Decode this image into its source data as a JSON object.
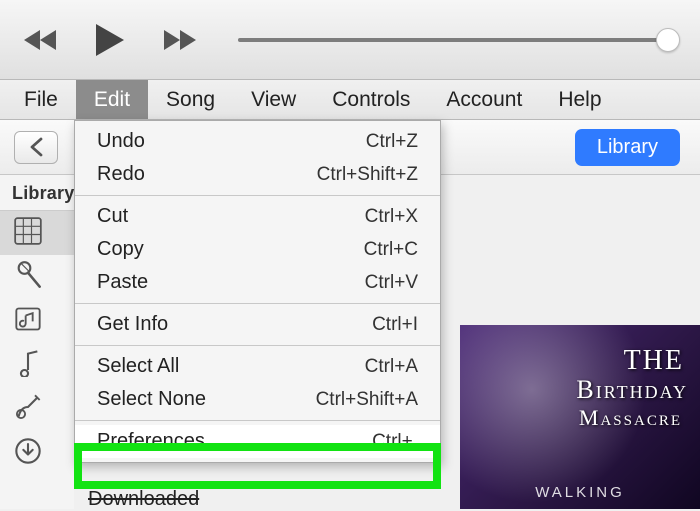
{
  "menubar": {
    "file": "File",
    "edit": "Edit",
    "song": "Song",
    "view": "View",
    "controls": "Controls",
    "account": "Account",
    "help": "Help"
  },
  "subbar": {
    "library_btn": "Library"
  },
  "library": {
    "heading": "Library"
  },
  "dropdown": {
    "undo": {
      "label": "Undo",
      "shortcut": "Ctrl+Z"
    },
    "redo": {
      "label": "Redo",
      "shortcut": "Ctrl+Shift+Z"
    },
    "cut": {
      "label": "Cut",
      "shortcut": "Ctrl+X"
    },
    "copy": {
      "label": "Copy",
      "shortcut": "Ctrl+C"
    },
    "paste": {
      "label": "Paste",
      "shortcut": "Ctrl+V"
    },
    "getinfo": {
      "label": "Get Info",
      "shortcut": "Ctrl+I"
    },
    "selectall": {
      "label": "Select All",
      "shortcut": "Ctrl+A"
    },
    "selectnone": {
      "label": "Select None",
      "shortcut": "Ctrl+Shift+A"
    },
    "prefs": {
      "label": "Preferences...",
      "shortcut": "Ctrl+,"
    }
  },
  "album": {
    "line1": "THE",
    "line2": "Birthday",
    "line3": "Massacre",
    "sub": "WALKING"
  },
  "misc": {
    "downloaded": "Downloaded"
  }
}
